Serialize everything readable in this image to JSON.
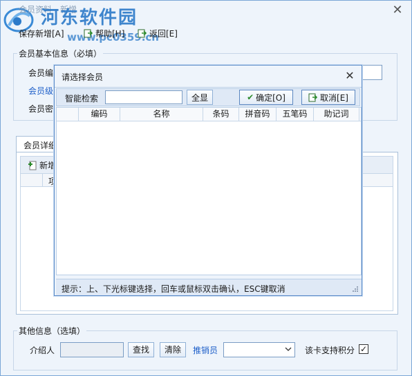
{
  "window": {
    "title": "会员资料 - 新增",
    "watermark_text": "河东软件园",
    "watermark_url": "www.pc0359.cn"
  },
  "toolbar": {
    "save_label": "保存新增[A]",
    "help_label": "帮助[H]",
    "back_label": "返回[E]"
  },
  "basic_info": {
    "title": "会员基本信息（必填）",
    "member_code_label": "会员编",
    "member_level_label": "会员级",
    "password_label": "会员密"
  },
  "details": {
    "tab_label": "会员详细",
    "add_label": "新增",
    "column_item": "项"
  },
  "other_info": {
    "title": "其他信息（选填）",
    "referrer_label": "介绍人",
    "find_button": "查找",
    "clear_button": "清除",
    "salesperson_label": "推销员",
    "points_label": "该卡支持积分",
    "points_checked": true
  },
  "dialog": {
    "title": "请选择会员",
    "search_label": "智能检索",
    "search_value": "",
    "show_all_button": "全显",
    "confirm_button": "确定[O]",
    "cancel_button": "取消[E]",
    "columns": [
      "编码",
      "名称",
      "条码",
      "拼音码",
      "五笔码",
      "助记词"
    ],
    "status_hint": "提示：上、下光标键选择，回车或鼠标双击确认，ESC键取消"
  },
  "colors": {
    "accent": "#2c7ac9",
    "window_bg": "#eef4fb",
    "border": "#7aa6d6"
  }
}
